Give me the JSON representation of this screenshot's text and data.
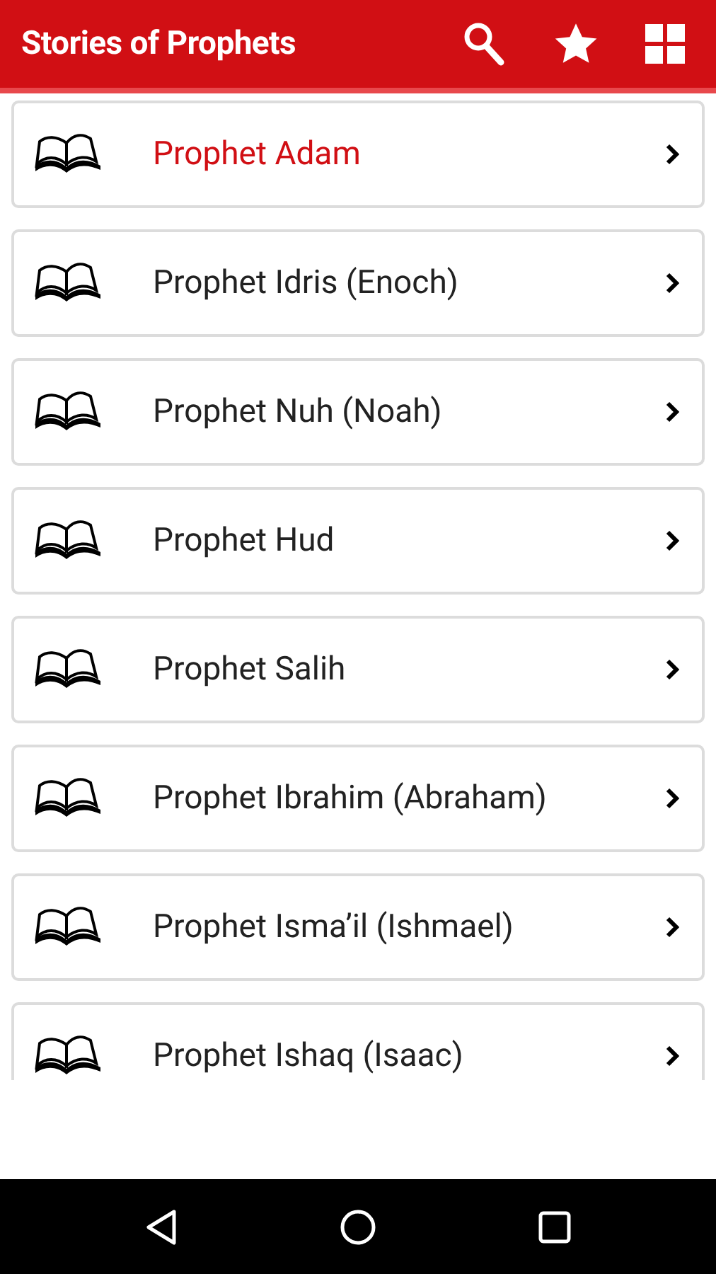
{
  "app_bar": {
    "title": "Stories of Prophets"
  },
  "items": [
    {
      "label": "Prophet Adam",
      "selected": true
    },
    {
      "label": "Prophet Idris (Enoch)",
      "selected": false
    },
    {
      "label": "Prophet Nuh (Noah)",
      "selected": false
    },
    {
      "label": "Prophet Hud",
      "selected": false
    },
    {
      "label": "Prophet Salih",
      "selected": false
    },
    {
      "label": "Prophet Ibrahim (Abraham)",
      "selected": false
    },
    {
      "label": "Prophet Isma’il (Ishmael)",
      "selected": false
    },
    {
      "label": "Prophet Ishaq (Isaac)",
      "selected": false
    }
  ]
}
